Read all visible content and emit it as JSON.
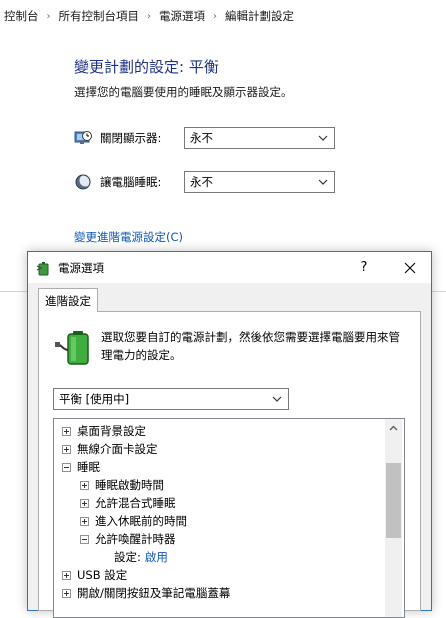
{
  "breadcrumb": {
    "items": [
      "控制台",
      "所有控制台項目",
      "電源選項",
      "編輯計劃設定"
    ],
    "separator": "›"
  },
  "page": {
    "title": "變更計劃的設定: 平衡",
    "subtitle": "選擇您的電腦要使用的睡眠及顯示器設定。",
    "display_label": "關閉顯示器:",
    "display_value": "永不",
    "sleep_label": "讓電腦睡眠:",
    "sleep_value": "永不",
    "advanced_link": "變更進階電源設定(C)"
  },
  "dialog": {
    "title": "電源選項",
    "help_label": "?",
    "tab_label": "進階設定",
    "description": "選取您要自訂的電源計劃，然後依您需要選擇電腦要用來管理電力的設定。",
    "plan_value": "平衡 [使用中]",
    "tree": {
      "desktop_bg": "桌面背景設定",
      "wireless": "無線介面卡設定",
      "sleep": "睡眠",
      "sleep_after": "睡眠啟動時間",
      "hybrid": "允許混合式睡眠",
      "hibernate": "進入休眠前的時間",
      "wake_timers": "允許喚醒計時器",
      "setting_label": "設定:",
      "setting_value": "啟用",
      "usb": "USB 設定",
      "power_buttons": "開啟/關閉按鈕及筆記電腦蓋幕"
    }
  },
  "colors": {
    "title_blue": "#1e3287",
    "link_blue": "#0f57b8",
    "dialog_border": "#2b74c0"
  },
  "icons": [
    "chevron-down-icon",
    "display-clock-icon",
    "moon-icon",
    "battery-plug-icon",
    "close-icon",
    "scroll-up-icon"
  ]
}
